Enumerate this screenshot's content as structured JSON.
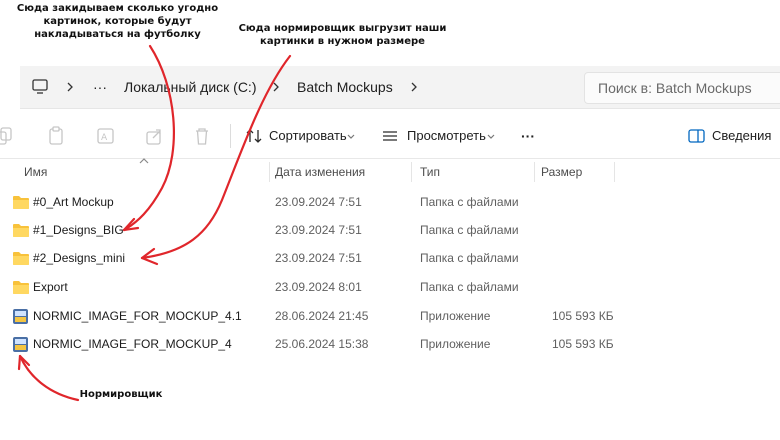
{
  "annotations": {
    "top_left": "Сюда закидываем сколько угодно картинок, которые будут накладываться на футболку",
    "top_center": "Сюда нормировщик выгрузит наши картинки в нужном размере",
    "bottom": "Нормировщик"
  },
  "address_bar": {
    "more": "···",
    "crumb1": "Локальный диск (C:)",
    "crumb2": "Batch Mockups",
    "search_placeholder": "Поиск в: Batch Mockups"
  },
  "toolbar": {
    "sort_label": "Сортировать",
    "view_label": "Просмотреть",
    "more_label": "···",
    "details_label": "Сведения"
  },
  "columns": {
    "name": "Имя",
    "date": "Дата изменения",
    "type": "Тип",
    "size": "Размер"
  },
  "files": [
    {
      "name": "#0_Art Mockup",
      "date": "23.09.2024 7:51",
      "type": "Папка с файлами",
      "size": "",
      "icon": "folder-icon"
    },
    {
      "name": "#1_Designs_BIG",
      "date": "23.09.2024 7:51",
      "type": "Папка с файлами",
      "size": "",
      "icon": "folder-icon"
    },
    {
      "name": "#2_Designs_mini",
      "date": "23.09.2024 7:51",
      "type": "Папка с файлами",
      "size": "",
      "icon": "folder-icon"
    },
    {
      "name": "Export",
      "date": "23.09.2024 8:01",
      "type": "Папка с файлами",
      "size": "",
      "icon": "folder-icon"
    },
    {
      "name": "NORMIC_IMAGE_FOR_MOCKUP_4.1",
      "date": "28.06.2024 21:45",
      "type": "Приложение",
      "size": "105 593 КБ",
      "icon": "app-icon"
    },
    {
      "name": "NORMIC_IMAGE_FOR_MOCKUP_4",
      "date": "25.06.2024 15:38",
      "type": "Приложение",
      "size": "105 593 КБ",
      "icon": "app-icon"
    }
  ],
  "colors": {
    "folder": "#f8c23b",
    "annotation_arrow": "#e0262b",
    "accent": "#0067c0"
  }
}
